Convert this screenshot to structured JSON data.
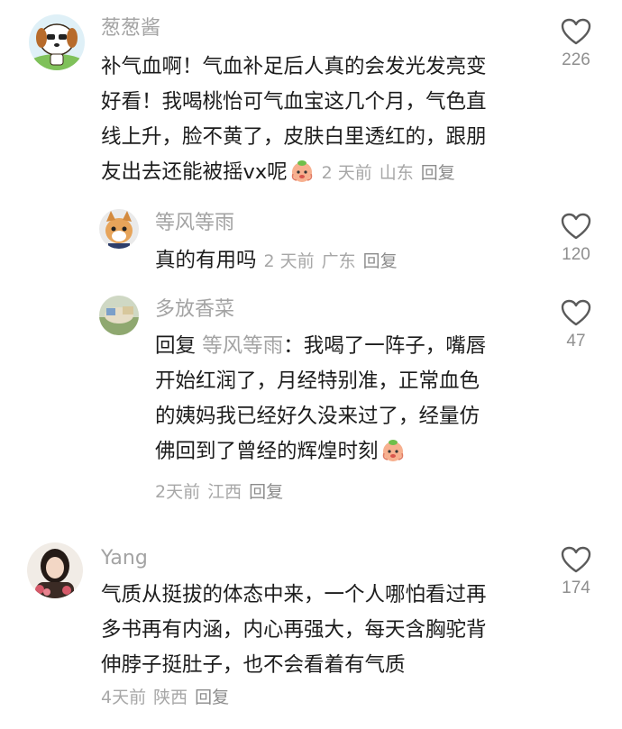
{
  "comments": [
    {
      "username": "葱葱酱",
      "avatar_icon": "cartoon-dog-avatar",
      "lines": [
        "补气血啊！气血补足后人真的会发光发亮变",
        "好看！我喝桃怡可气血宝这几个月，气色直",
        "线上升，脸不黄了，皮肤白里透红的，跟朋",
        "友出去还能被摇vx呢"
      ],
      "emoji": "peach-face-emoji",
      "time": "2 天前",
      "location": "山东",
      "reply_label": "回复",
      "likes": "226"
    },
    {
      "username": "等风等雨",
      "avatar_icon": "cat-avatar",
      "lines": [
        "真的有用吗"
      ],
      "time": "2 天前",
      "location": "广东",
      "reply_label": "回复",
      "likes": "120"
    },
    {
      "username": "多放香菜",
      "avatar_icon": "photo-avatar",
      "reply_prefix": "回复",
      "mention": "等风等雨",
      "lines": [
        "：我喝了一阵子，嘴唇",
        "开始红润了，月经特别准，正常血色",
        "的姨妈我已经好久没来过了，经量仿",
        "佛回到了曾经的辉煌时刻"
      ],
      "emoji": "peach-face-emoji",
      "time": "2天前",
      "location": "江西",
      "reply_label": "回复",
      "likes": "47"
    },
    {
      "username": "Yang",
      "avatar_icon": "woman-portrait-avatar",
      "lines": [
        "气质从挺拔的体态中来，一个人哪怕看过再",
        "多书再有内涵，内心再强大，每天含胸驼背",
        "伸脖子挺肚子，也不会看着有气质"
      ],
      "time": "4天前",
      "location": "陕西",
      "reply_label": "回复",
      "likes": "174"
    }
  ]
}
